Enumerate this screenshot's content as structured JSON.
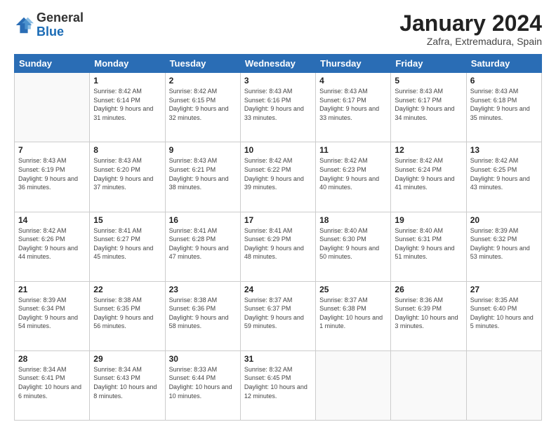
{
  "logo": {
    "general": "General",
    "blue": "Blue"
  },
  "title": "January 2024",
  "subtitle": "Zafra, Extremadura, Spain",
  "days_header": [
    "Sunday",
    "Monday",
    "Tuesday",
    "Wednesday",
    "Thursday",
    "Friday",
    "Saturday"
  ],
  "weeks": [
    [
      {
        "day": "",
        "sunrise": "",
        "sunset": "",
        "daylight": ""
      },
      {
        "day": "1",
        "sunrise": "Sunrise: 8:42 AM",
        "sunset": "Sunset: 6:14 PM",
        "daylight": "Daylight: 9 hours and 31 minutes."
      },
      {
        "day": "2",
        "sunrise": "Sunrise: 8:42 AM",
        "sunset": "Sunset: 6:15 PM",
        "daylight": "Daylight: 9 hours and 32 minutes."
      },
      {
        "day": "3",
        "sunrise": "Sunrise: 8:43 AM",
        "sunset": "Sunset: 6:16 PM",
        "daylight": "Daylight: 9 hours and 33 minutes."
      },
      {
        "day": "4",
        "sunrise": "Sunrise: 8:43 AM",
        "sunset": "Sunset: 6:17 PM",
        "daylight": "Daylight: 9 hours and 33 minutes."
      },
      {
        "day": "5",
        "sunrise": "Sunrise: 8:43 AM",
        "sunset": "Sunset: 6:17 PM",
        "daylight": "Daylight: 9 hours and 34 minutes."
      },
      {
        "day": "6",
        "sunrise": "Sunrise: 8:43 AM",
        "sunset": "Sunset: 6:18 PM",
        "daylight": "Daylight: 9 hours and 35 minutes."
      }
    ],
    [
      {
        "day": "7",
        "sunrise": "Sunrise: 8:43 AM",
        "sunset": "Sunset: 6:19 PM",
        "daylight": "Daylight: 9 hours and 36 minutes."
      },
      {
        "day": "8",
        "sunrise": "Sunrise: 8:43 AM",
        "sunset": "Sunset: 6:20 PM",
        "daylight": "Daylight: 9 hours and 37 minutes."
      },
      {
        "day": "9",
        "sunrise": "Sunrise: 8:43 AM",
        "sunset": "Sunset: 6:21 PM",
        "daylight": "Daylight: 9 hours and 38 minutes."
      },
      {
        "day": "10",
        "sunrise": "Sunrise: 8:42 AM",
        "sunset": "Sunset: 6:22 PM",
        "daylight": "Daylight: 9 hours and 39 minutes."
      },
      {
        "day": "11",
        "sunrise": "Sunrise: 8:42 AM",
        "sunset": "Sunset: 6:23 PM",
        "daylight": "Daylight: 9 hours and 40 minutes."
      },
      {
        "day": "12",
        "sunrise": "Sunrise: 8:42 AM",
        "sunset": "Sunset: 6:24 PM",
        "daylight": "Daylight: 9 hours and 41 minutes."
      },
      {
        "day": "13",
        "sunrise": "Sunrise: 8:42 AM",
        "sunset": "Sunset: 6:25 PM",
        "daylight": "Daylight: 9 hours and 43 minutes."
      }
    ],
    [
      {
        "day": "14",
        "sunrise": "Sunrise: 8:42 AM",
        "sunset": "Sunset: 6:26 PM",
        "daylight": "Daylight: 9 hours and 44 minutes."
      },
      {
        "day": "15",
        "sunrise": "Sunrise: 8:41 AM",
        "sunset": "Sunset: 6:27 PM",
        "daylight": "Daylight: 9 hours and 45 minutes."
      },
      {
        "day": "16",
        "sunrise": "Sunrise: 8:41 AM",
        "sunset": "Sunset: 6:28 PM",
        "daylight": "Daylight: 9 hours and 47 minutes."
      },
      {
        "day": "17",
        "sunrise": "Sunrise: 8:41 AM",
        "sunset": "Sunset: 6:29 PM",
        "daylight": "Daylight: 9 hours and 48 minutes."
      },
      {
        "day": "18",
        "sunrise": "Sunrise: 8:40 AM",
        "sunset": "Sunset: 6:30 PM",
        "daylight": "Daylight: 9 hours and 50 minutes."
      },
      {
        "day": "19",
        "sunrise": "Sunrise: 8:40 AM",
        "sunset": "Sunset: 6:31 PM",
        "daylight": "Daylight: 9 hours and 51 minutes."
      },
      {
        "day": "20",
        "sunrise": "Sunrise: 8:39 AM",
        "sunset": "Sunset: 6:32 PM",
        "daylight": "Daylight: 9 hours and 53 minutes."
      }
    ],
    [
      {
        "day": "21",
        "sunrise": "Sunrise: 8:39 AM",
        "sunset": "Sunset: 6:34 PM",
        "daylight": "Daylight: 9 hours and 54 minutes."
      },
      {
        "day": "22",
        "sunrise": "Sunrise: 8:38 AM",
        "sunset": "Sunset: 6:35 PM",
        "daylight": "Daylight: 9 hours and 56 minutes."
      },
      {
        "day": "23",
        "sunrise": "Sunrise: 8:38 AM",
        "sunset": "Sunset: 6:36 PM",
        "daylight": "Daylight: 9 hours and 58 minutes."
      },
      {
        "day": "24",
        "sunrise": "Sunrise: 8:37 AM",
        "sunset": "Sunset: 6:37 PM",
        "daylight": "Daylight: 9 hours and 59 minutes."
      },
      {
        "day": "25",
        "sunrise": "Sunrise: 8:37 AM",
        "sunset": "Sunset: 6:38 PM",
        "daylight": "Daylight: 10 hours and 1 minute."
      },
      {
        "day": "26",
        "sunrise": "Sunrise: 8:36 AM",
        "sunset": "Sunset: 6:39 PM",
        "daylight": "Daylight: 10 hours and 3 minutes."
      },
      {
        "day": "27",
        "sunrise": "Sunrise: 8:35 AM",
        "sunset": "Sunset: 6:40 PM",
        "daylight": "Daylight: 10 hours and 5 minutes."
      }
    ],
    [
      {
        "day": "28",
        "sunrise": "Sunrise: 8:34 AM",
        "sunset": "Sunset: 6:41 PM",
        "daylight": "Daylight: 10 hours and 6 minutes."
      },
      {
        "day": "29",
        "sunrise": "Sunrise: 8:34 AM",
        "sunset": "Sunset: 6:43 PM",
        "daylight": "Daylight: 10 hours and 8 minutes."
      },
      {
        "day": "30",
        "sunrise": "Sunrise: 8:33 AM",
        "sunset": "Sunset: 6:44 PM",
        "daylight": "Daylight: 10 hours and 10 minutes."
      },
      {
        "day": "31",
        "sunrise": "Sunrise: 8:32 AM",
        "sunset": "Sunset: 6:45 PM",
        "daylight": "Daylight: 10 hours and 12 minutes."
      },
      {
        "day": "",
        "sunrise": "",
        "sunset": "",
        "daylight": ""
      },
      {
        "day": "",
        "sunrise": "",
        "sunset": "",
        "daylight": ""
      },
      {
        "day": "",
        "sunrise": "",
        "sunset": "",
        "daylight": ""
      }
    ]
  ]
}
